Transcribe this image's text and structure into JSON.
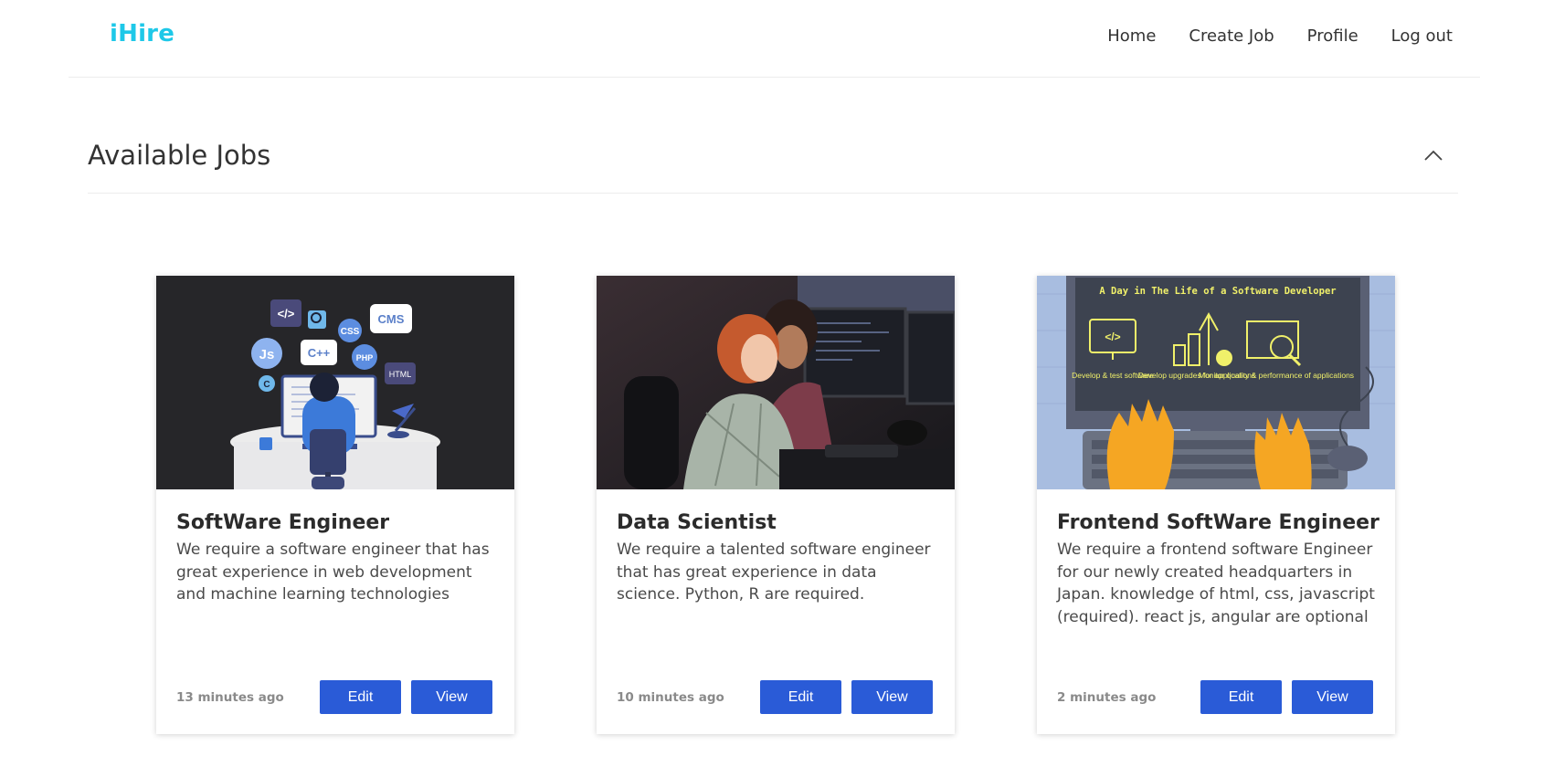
{
  "header": {
    "brand": "iHire",
    "nav": [
      "Home",
      "Create Job",
      "Profile",
      "Log out"
    ]
  },
  "section": {
    "title": "Available Jobs"
  },
  "jobs": [
    {
      "title": "SoftWare Engineer",
      "description": "We require a software engineer that has great experience in web development and machine learning technologies",
      "time": "13 minutes ago",
      "edit_label": "Edit",
      "view_label": "View",
      "image_labels": [
        "</>",
        "CSS",
        "CMS",
        "Js",
        "C++",
        "PHP",
        "HTML",
        "C"
      ]
    },
    {
      "title": "Data Scientist",
      "description": "We require a talented software engineer that has great experience in data science. Python, R are required.",
      "time": "10 minutes ago",
      "edit_label": "Edit",
      "view_label": "View"
    },
    {
      "title": "Frontend SoftWare Engineer",
      "description": "We require a frontend software Engineer for our newly created headquarters in Japan. knowledge of html, css, javascript (required). react js, angular are optional",
      "time": "2 minutes ago",
      "edit_label": "Edit",
      "view_label": "View",
      "image_labels": {
        "heading": "A Day in The Life of a Software Developer",
        "item1": "Develop & test software",
        "item2": "Develop upgrades for applications",
        "item3": "Monitor quality & performance of applications"
      }
    }
  ],
  "colors": {
    "brand": "#1ec8e8",
    "button": "#2a5bd7"
  },
  "icons": {
    "collapse": "chevron-up-icon"
  }
}
